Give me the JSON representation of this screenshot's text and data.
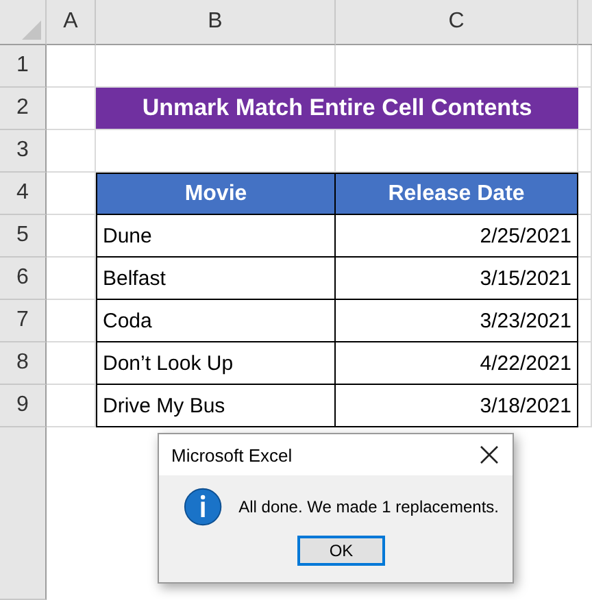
{
  "column_headers": [
    "A",
    "B",
    "C"
  ],
  "row_headers": [
    "1",
    "2",
    "3",
    "4",
    "5",
    "6",
    "7",
    "8",
    "9"
  ],
  "title": "Unmark Match Entire Cell Contents",
  "table": {
    "columns": [
      "Movie",
      "Release Date"
    ],
    "rows": [
      [
        "Dune",
        "2/25/2021"
      ],
      [
        "Belfast",
        "3/15/2021"
      ],
      [
        "Coda",
        "3/23/2021"
      ],
      [
        "Don’t Look Up",
        "4/22/2021"
      ],
      [
        "Drive My Bus",
        "3/18/2021"
      ]
    ]
  },
  "dialog": {
    "title": "Microsoft Excel",
    "message": "All done. We made 1 replacements.",
    "buttons": [
      {
        "label": "OK",
        "focused": true
      }
    ]
  }
}
